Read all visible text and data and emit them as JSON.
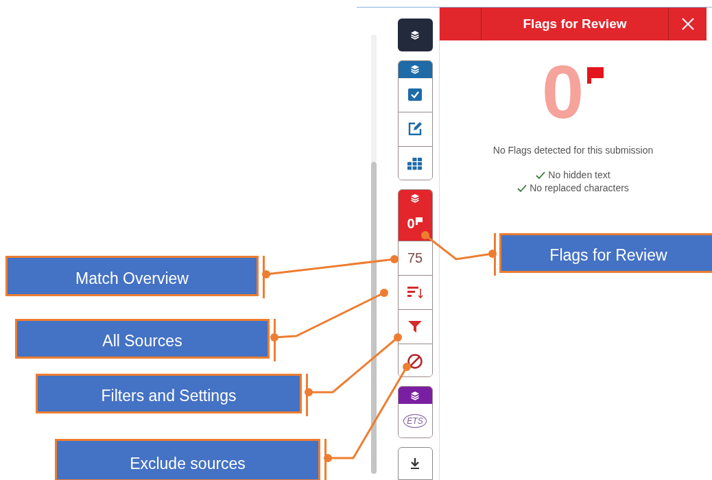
{
  "sidebar": {
    "groups": [
      {
        "kind": "single",
        "color": "#232a3b",
        "items": [
          {
            "kind": "layers"
          }
        ]
      },
      {
        "kind": "group",
        "color": "#1e6ba8",
        "items": [
          {
            "kind": "check",
            "selected": false
          },
          {
            "kind": "edit",
            "selected": false
          },
          {
            "kind": "grid",
            "selected": false
          }
        ]
      },
      {
        "kind": "group",
        "color": "#e3262b",
        "items": [
          {
            "kind": "flags",
            "text": "0",
            "selected": true
          },
          {
            "kind": "score",
            "text": "75",
            "selected": false
          },
          {
            "kind": "sort",
            "selected": false
          },
          {
            "kind": "filter",
            "selected": false
          },
          {
            "kind": "exclude",
            "selected": false
          }
        ]
      },
      {
        "kind": "group",
        "color": "#7a1fa2",
        "items": [
          {
            "kind": "ets",
            "text": "ETS",
            "selected": false
          }
        ]
      },
      {
        "kind": "plain",
        "color": "#ffffff",
        "items": [
          {
            "kind": "download"
          }
        ]
      }
    ]
  },
  "panel": {
    "title": "Flags for Review",
    "count": "0",
    "message": "No Flags detected for this submission",
    "checks": [
      "No hidden text",
      "No replaced characters"
    ]
  },
  "callouts": [
    {
      "label": "Flags for Review"
    },
    {
      "label": "Match Overview"
    },
    {
      "label": "All Sources"
    },
    {
      "label": "Filters and Settings"
    },
    {
      "label": "Exclude sources"
    }
  ]
}
